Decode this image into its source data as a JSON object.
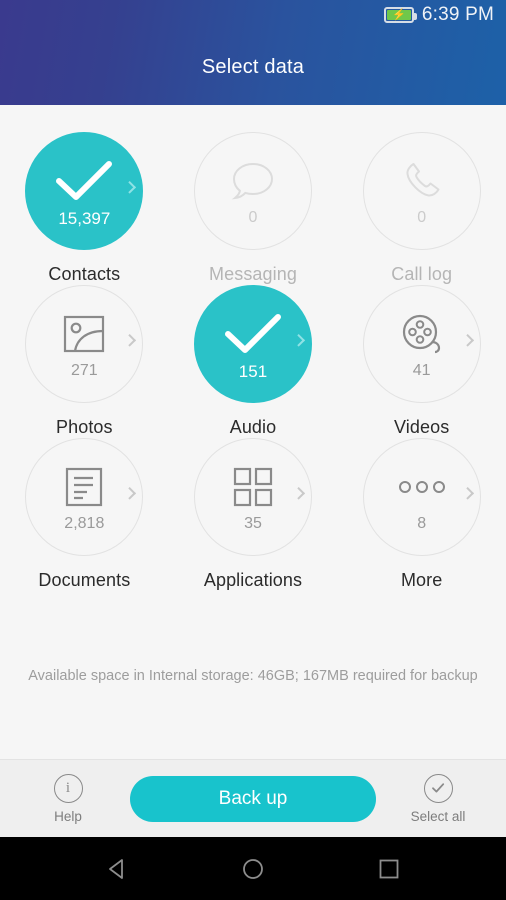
{
  "statusbar": {
    "time": "6:39 PM",
    "battery_icon": "battery-charging-icon",
    "battery_color": "#6fc84a"
  },
  "header": {
    "title": "Select data",
    "gradient_from": "#3a3a8e",
    "gradient_to": "#1d61a8"
  },
  "theme": {
    "accent": "#2ac2c8",
    "button_accent": "#18c3cc",
    "background": "#f6f6f6",
    "actionbar_background": "#efefef",
    "circle_border": "#e2e2e2",
    "label_color": "#2b2b2b",
    "disabled_color": "#b5b5b5"
  },
  "grid": {
    "items": [
      {
        "id": "contacts",
        "label": "Contacts",
        "count": "15,397",
        "icon": "check-icon",
        "selected": true,
        "disabled": false,
        "chevron": true
      },
      {
        "id": "messaging",
        "label": "Messaging",
        "count": "0",
        "icon": "speech-bubble-icon",
        "selected": false,
        "disabled": true,
        "chevron": false
      },
      {
        "id": "call-log",
        "label": "Call log",
        "count": "0",
        "icon": "phone-icon",
        "selected": false,
        "disabled": true,
        "chevron": false
      },
      {
        "id": "photos",
        "label": "Photos",
        "count": "271",
        "icon": "image-icon",
        "selected": false,
        "disabled": false,
        "chevron": true
      },
      {
        "id": "audio",
        "label": "Audio",
        "count": "151",
        "icon": "check-icon",
        "selected": true,
        "disabled": false,
        "chevron": true
      },
      {
        "id": "videos",
        "label": "Videos",
        "count": "41",
        "icon": "film-reel-icon",
        "selected": false,
        "disabled": false,
        "chevron": true
      },
      {
        "id": "documents",
        "label": "Documents",
        "count": "2,818",
        "icon": "document-icon",
        "selected": false,
        "disabled": false,
        "chevron": true
      },
      {
        "id": "applications",
        "label": "Applications",
        "count": "35",
        "icon": "apps-grid-icon",
        "selected": false,
        "disabled": false,
        "chevron": true
      },
      {
        "id": "more",
        "label": "More",
        "count": "8",
        "icon": "ellipsis-icon",
        "selected": false,
        "disabled": false,
        "chevron": true
      }
    ]
  },
  "storage": {
    "note": "Available space in Internal storage: 46GB; 167MB required for backup"
  },
  "actionbar": {
    "help_label": "Help",
    "help_icon": "info-circle-icon",
    "backup_label": "Back up",
    "select_all_label": "Select all",
    "select_all_icon": "check-circle-icon"
  },
  "navbar": {
    "back_icon": "triangle-back-icon",
    "home_icon": "circle-home-icon",
    "recents_icon": "square-recents-icon"
  }
}
